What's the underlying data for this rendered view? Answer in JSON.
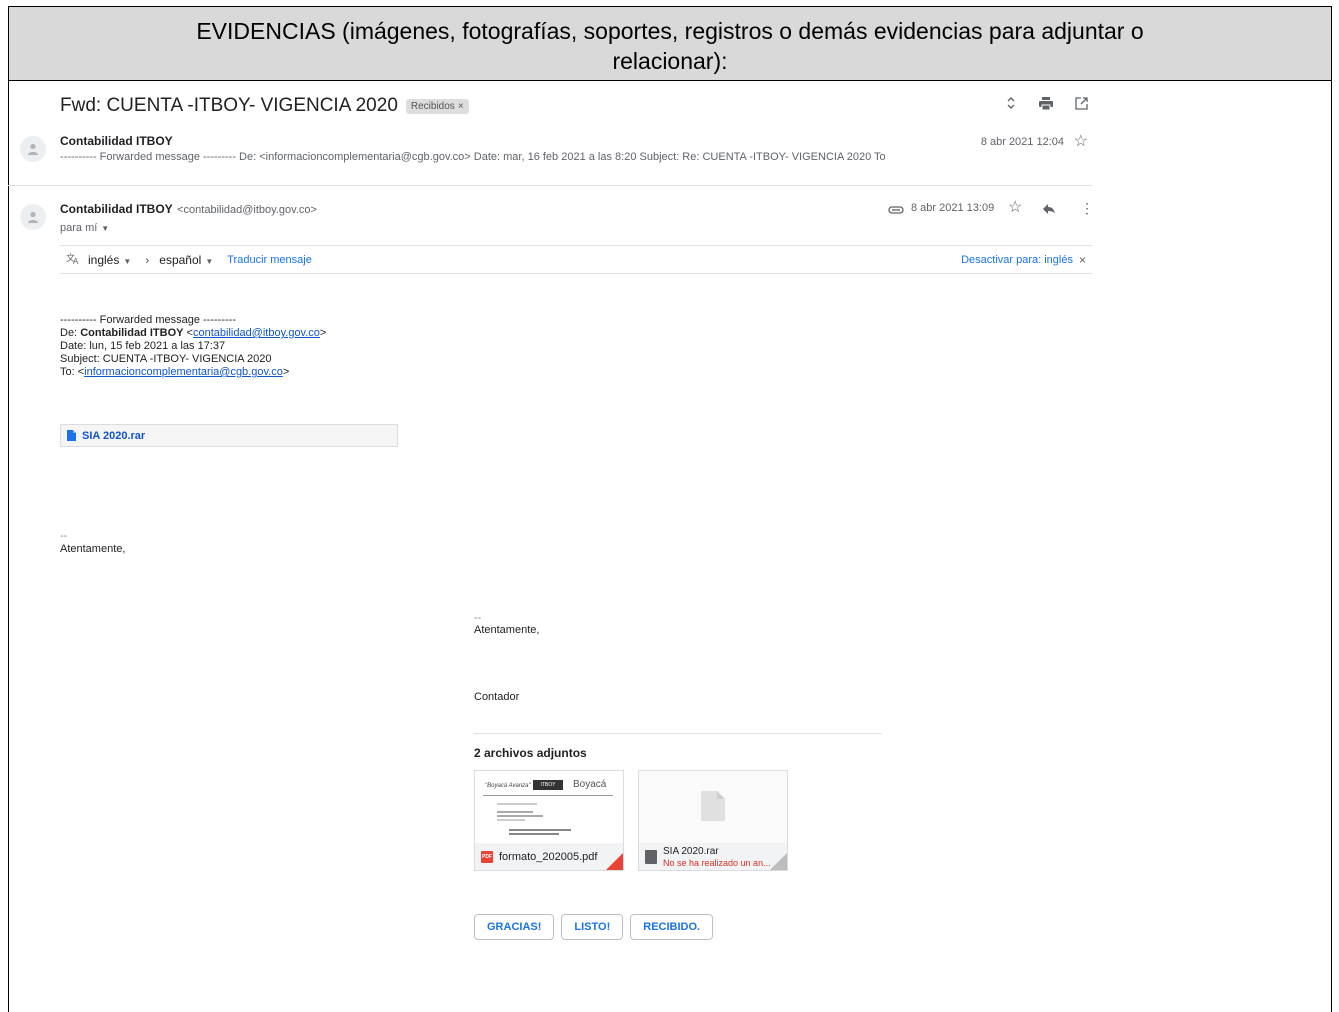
{
  "evidence_header": {
    "line1": "EVIDENCIAS (imágenes, fotografías, soportes, registros o demás evidencias para adjuntar o",
    "line2": "relacionar):"
  },
  "thread": {
    "subject": "Fwd: CUENTA -ITBOY- VIGENCIA 2020",
    "label": "Recibidos",
    "label_close": "×",
    "icons": [
      "expand-collapse-icon",
      "print-icon",
      "open-new-window-icon"
    ]
  },
  "message1": {
    "sender": "Contabilidad ITBOY",
    "snippet": "---------- Forwarded message --------- De: <informacioncomplementaria@cgb.gov.co> Date: mar, 16 feb 2021 a las 8:20 Subject: Re: CUENTA -ITBOY- VIGENCIA 2020 To",
    "date": "8 abr 2021 12:04"
  },
  "message2": {
    "sender": "Contabilidad ITBOY",
    "sender_email": "<contabilidad@itboy.gov.co>",
    "to_me": "para mí",
    "date": "8 abr 2021 13:09"
  },
  "translate_bar": {
    "from_lang": "inglés",
    "arrow": "›",
    "to_lang": "español",
    "translate_link": "Traducir mensaje",
    "disable_link": "Desactivar para: inglés",
    "close": "×"
  },
  "forwarded": {
    "heading": "---------- Forwarded message ---------",
    "from_label": "De:",
    "from_name": "Contabilidad ITBOY",
    "from_open": "<",
    "from_email": "contabilidad@itboy.gov.co",
    "from_close": ">",
    "date": "Date: lun, 15 feb 2021 a las 17:37",
    "subject": "Subject: CUENTA -ITBOY- VIGENCIA 2020",
    "to_label": "To: <",
    "to_email": "informacioncomplementaria@cgb.gov.co",
    "to_close": ">"
  },
  "inline_attachment": {
    "name": "SIA 2020.rar"
  },
  "signature1": {
    "dashes": "--",
    "closing": "Atentamente,"
  },
  "signature2": {
    "dashes": "--",
    "closing": "Atentamente,",
    "role": "Contador"
  },
  "attachments": {
    "title": "2 archivos adjuntos",
    "items": [
      {
        "name": "formato_202005.pdf",
        "type_badge": "PDF",
        "preview_text1": "\"Boyacá Avanza\"",
        "preview_text2": "ITBOY",
        "preview_text3": "Boyacá"
      },
      {
        "name": "SIA 2020.rar",
        "status": "No se ha realizado un an..."
      }
    ]
  },
  "smart_replies": [
    "GRACIAS!",
    "LISTO!",
    "RECIBIDO."
  ]
}
